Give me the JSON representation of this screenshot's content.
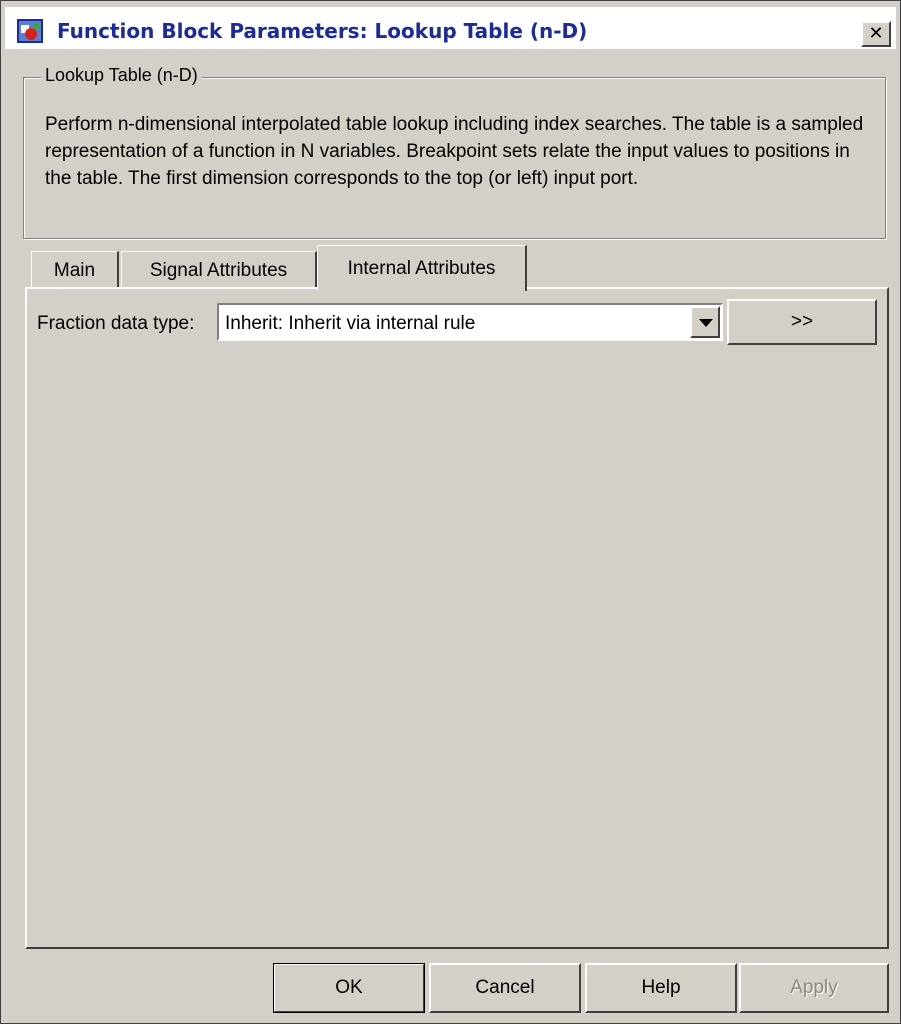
{
  "window": {
    "title": "Function Block Parameters: Lookup Table (n-D)",
    "close_label": "✕"
  },
  "group": {
    "legend": "Lookup Table (n-D)",
    "description": "Perform n-dimensional interpolated table lookup including index searches. The table is a sampled representation of a function in N variables. Breakpoint sets relate the input values to positions in the table. The first dimension corresponds to the top (or left) input port."
  },
  "tabs": [
    {
      "label": "Main",
      "active": false
    },
    {
      "label": "Signal Attributes",
      "active": false
    },
    {
      "label": "Internal Attributes",
      "active": true
    }
  ],
  "fraction_data_type": {
    "label": "Fraction data type:",
    "value": "Inherit: Inherit via internal rule",
    "show_assistant_label": ">>"
  },
  "buttons": {
    "ok": "OK",
    "cancel": "Cancel",
    "help": "Help",
    "apply": "Apply",
    "apply_enabled": false
  },
  "icons": {
    "app": "simulink-block-icon",
    "dropdown": "chevron-down-icon"
  },
  "colors": {
    "title_text": "#1b2b9e",
    "dialog_background": "#d4d0c8"
  }
}
